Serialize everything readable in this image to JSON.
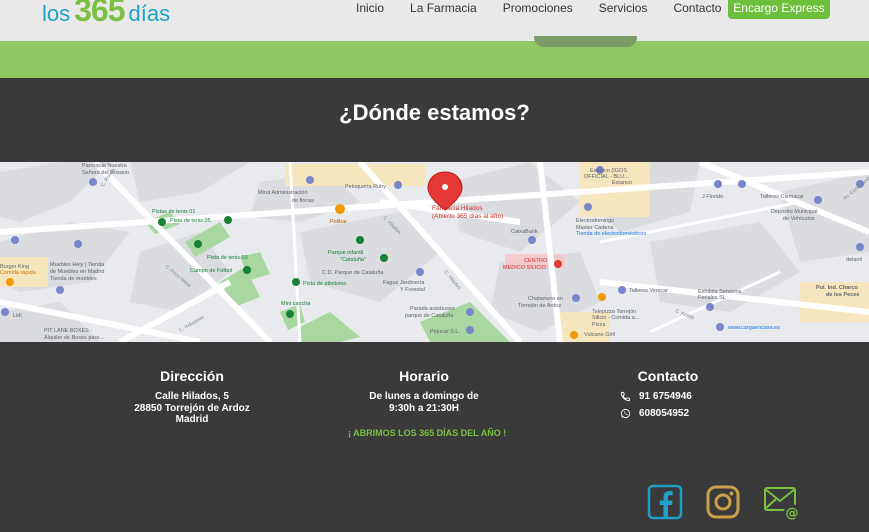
{
  "logo": {
    "left": "los",
    "number": "365",
    "right": "días"
  },
  "nav": {
    "items": [
      "Inicio",
      "La Farmacia",
      "Promociones",
      "Servicios",
      "Contacto"
    ],
    "cta": "Encargo Express"
  },
  "section_title": "¿Dónde estamos?",
  "map": {
    "pin_label": [
      "Farmacia Hilados",
      "(Abierto 365 días al año)"
    ],
    "labels": [
      "Parroquia Nuestra",
      "Señora del Rosario",
      "Mirut Administración",
      "de fincas",
      "Peluquería Ruby",
      "Pistas de tenis 01",
      "Pista de tenis 05",
      "Polibar",
      "Pista de tenis 03",
      "Campo de Fútbol",
      "Parque infantil",
      "\"Cataluña\"",
      "C.D. Parque de Cataluña",
      "Pista de atletismo",
      "Fagus Jardinería",
      "Y Forestal",
      "Mini cancha",
      "Parada autobuses",
      "parque de Cataluña",
      "Pejucar S.L.",
      "Burger King",
      "Comida rápida",
      "Muebles Hely | Tienda",
      "de Muebles en Madrid",
      "Tienda de muebles",
      "PIT LANE BOXES -",
      "Alquiler de Boxes para...",
      "Lidl",
      "Estanco (IGOS",
      "OFFICIAL - BLU...",
      "Estanco",
      "CaixaBank",
      "Electrodomingo",
      "Master Cadena",
      "Tienda de electrodomésticos",
      "CENTRO",
      "MEDICO SILICIO",
      "Chatamero en",
      "Torrejón de Ardoz",
      "J Florido",
      "Talleres Clemacar",
      "Depósito Municipal",
      "de Vehículos",
      "Talleres Vinecar",
      "Exhibita Servicios",
      "Feriales SL",
      "Telepizza Torrejón",
      "Silicio - Comida a...",
      "Pizza",
      "Vulcano Grill",
      "www.cargaencasa.es",
      "Pol. Ind. Charco",
      "de los Peces",
      "delaoli",
      "C. Hilados",
      "C. Industrias",
      "C. Pozo Nieve",
      "C. Ronda",
      "Av. Constitución",
      "C. Azeite"
    ]
  },
  "address": {
    "heading": "Dirección",
    "lines": [
      "Calle Hilados, 5",
      "28850 Torrejón de Ardoz",
      "Madrid"
    ]
  },
  "hours": {
    "heading": "Horario",
    "lines": [
      "De lunes a domingo  de",
      "9:30h a 21:30H"
    ],
    "open_note": "¡ ABRIMOS LOS 365 DÍAS DEL AÑO !"
  },
  "contact": {
    "heading": "Contacto",
    "phone": "91 6754946",
    "whatsapp": "608054952"
  },
  "social": {
    "icons": [
      "facebook-icon",
      "instagram-icon",
      "email-icon"
    ],
    "colors": {
      "facebook": "#1fa0c9",
      "instagram": "#c9a14a",
      "email": "#7bc043"
    }
  },
  "colors": {
    "accent_green": "#7bc043",
    "accent_blue": "#1fa0c9",
    "pin_red": "#e53935",
    "band_green": "#8fc862"
  }
}
